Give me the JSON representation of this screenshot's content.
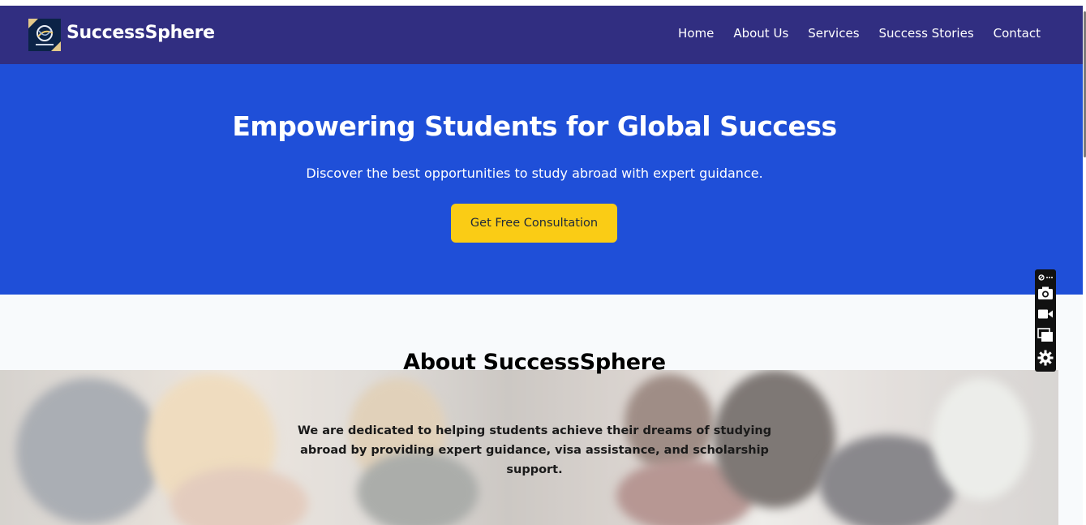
{
  "header": {
    "brand": "SuccessSphere",
    "logo_icon": "globe-logo-icon",
    "nav": [
      "Home",
      "About Us",
      "Services",
      "Success Stories",
      "Contact"
    ]
  },
  "hero": {
    "title": "Empowering Students for Global Success",
    "subtitle": "Discover the best opportunities to study abroad with expert guidance.",
    "cta_label": "Get Free Consultation"
  },
  "about": {
    "title": "About SuccessSphere",
    "text": "We are dedicated to helping students achieve their dreams of studying abroad by providing expert guidance, visa assistance, and scholarship support."
  },
  "floating_toolbar": {
    "items": [
      "link-more-icon",
      "camera-icon",
      "video-icon",
      "screens-icon",
      "settings-icon"
    ]
  },
  "colors": {
    "navbar": "#312e81",
    "hero": "#1f4fd8",
    "cta": "#facc15",
    "about_bg": "#f8fafc"
  }
}
